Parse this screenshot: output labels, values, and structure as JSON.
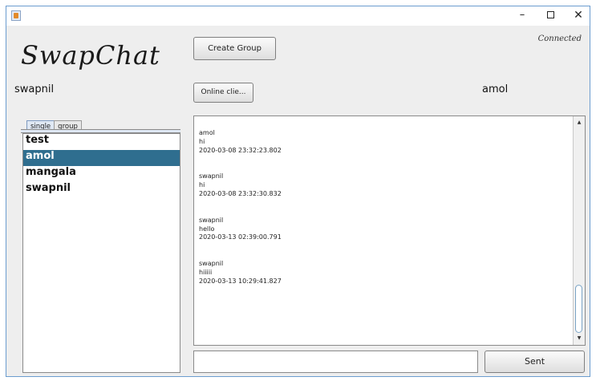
{
  "app": {
    "logo": "SwapChat",
    "status": "Connected"
  },
  "titlebar": {
    "minimize": "–",
    "maximize": "",
    "close": "✕"
  },
  "toolbar": {
    "create_group_label": "Create Group",
    "online_clients_label": "Online clie..."
  },
  "current_user": "swapnil",
  "chat_with": "amol",
  "tabs": [
    {
      "label": "single"
    },
    {
      "label": "group"
    }
  ],
  "users": [
    "test",
    "amol",
    "mangala",
    "swapnil"
  ],
  "selected_user": "amol",
  "messages": [
    {
      "sender": "amol",
      "text": "hi",
      "time": "2020-03-08 23:32:23.802"
    },
    {
      "sender": "swapnil",
      "text": "hi",
      "time": "2020-03-08 23:32:30.832"
    },
    {
      "sender": "swapnil",
      "text": "hello",
      "time": "2020-03-13 02:39:00.791"
    },
    {
      "sender": "swapnil",
      "text": "hiiiii",
      "time": "2020-03-13 10:29:41.827"
    }
  ],
  "composer": {
    "value": "",
    "send_label": "Sent"
  },
  "colors": {
    "selection": "#2f6e8f",
    "window_border": "#6b9ccf",
    "panel": "#eeeeee"
  }
}
